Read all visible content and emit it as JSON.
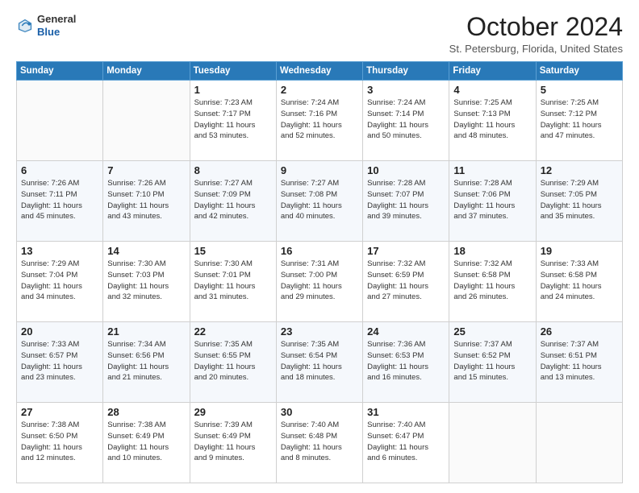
{
  "header": {
    "logo_general": "General",
    "logo_blue": "Blue",
    "month_title": "October 2024",
    "location": "St. Petersburg, Florida, United States"
  },
  "days_of_week": [
    "Sunday",
    "Monday",
    "Tuesday",
    "Wednesday",
    "Thursday",
    "Friday",
    "Saturday"
  ],
  "weeks": [
    [
      {
        "day": "",
        "detail": ""
      },
      {
        "day": "",
        "detail": ""
      },
      {
        "day": "1",
        "detail": "Sunrise: 7:23 AM\nSunset: 7:17 PM\nDaylight: 11 hours\nand 53 minutes."
      },
      {
        "day": "2",
        "detail": "Sunrise: 7:24 AM\nSunset: 7:16 PM\nDaylight: 11 hours\nand 52 minutes."
      },
      {
        "day": "3",
        "detail": "Sunrise: 7:24 AM\nSunset: 7:14 PM\nDaylight: 11 hours\nand 50 minutes."
      },
      {
        "day": "4",
        "detail": "Sunrise: 7:25 AM\nSunset: 7:13 PM\nDaylight: 11 hours\nand 48 minutes."
      },
      {
        "day": "5",
        "detail": "Sunrise: 7:25 AM\nSunset: 7:12 PM\nDaylight: 11 hours\nand 47 minutes."
      }
    ],
    [
      {
        "day": "6",
        "detail": "Sunrise: 7:26 AM\nSunset: 7:11 PM\nDaylight: 11 hours\nand 45 minutes."
      },
      {
        "day": "7",
        "detail": "Sunrise: 7:26 AM\nSunset: 7:10 PM\nDaylight: 11 hours\nand 43 minutes."
      },
      {
        "day": "8",
        "detail": "Sunrise: 7:27 AM\nSunset: 7:09 PM\nDaylight: 11 hours\nand 42 minutes."
      },
      {
        "day": "9",
        "detail": "Sunrise: 7:27 AM\nSunset: 7:08 PM\nDaylight: 11 hours\nand 40 minutes."
      },
      {
        "day": "10",
        "detail": "Sunrise: 7:28 AM\nSunset: 7:07 PM\nDaylight: 11 hours\nand 39 minutes."
      },
      {
        "day": "11",
        "detail": "Sunrise: 7:28 AM\nSunset: 7:06 PM\nDaylight: 11 hours\nand 37 minutes."
      },
      {
        "day": "12",
        "detail": "Sunrise: 7:29 AM\nSunset: 7:05 PM\nDaylight: 11 hours\nand 35 minutes."
      }
    ],
    [
      {
        "day": "13",
        "detail": "Sunrise: 7:29 AM\nSunset: 7:04 PM\nDaylight: 11 hours\nand 34 minutes."
      },
      {
        "day": "14",
        "detail": "Sunrise: 7:30 AM\nSunset: 7:03 PM\nDaylight: 11 hours\nand 32 minutes."
      },
      {
        "day": "15",
        "detail": "Sunrise: 7:30 AM\nSunset: 7:01 PM\nDaylight: 11 hours\nand 31 minutes."
      },
      {
        "day": "16",
        "detail": "Sunrise: 7:31 AM\nSunset: 7:00 PM\nDaylight: 11 hours\nand 29 minutes."
      },
      {
        "day": "17",
        "detail": "Sunrise: 7:32 AM\nSunset: 6:59 PM\nDaylight: 11 hours\nand 27 minutes."
      },
      {
        "day": "18",
        "detail": "Sunrise: 7:32 AM\nSunset: 6:58 PM\nDaylight: 11 hours\nand 26 minutes."
      },
      {
        "day": "19",
        "detail": "Sunrise: 7:33 AM\nSunset: 6:58 PM\nDaylight: 11 hours\nand 24 minutes."
      }
    ],
    [
      {
        "day": "20",
        "detail": "Sunrise: 7:33 AM\nSunset: 6:57 PM\nDaylight: 11 hours\nand 23 minutes."
      },
      {
        "day": "21",
        "detail": "Sunrise: 7:34 AM\nSunset: 6:56 PM\nDaylight: 11 hours\nand 21 minutes."
      },
      {
        "day": "22",
        "detail": "Sunrise: 7:35 AM\nSunset: 6:55 PM\nDaylight: 11 hours\nand 20 minutes."
      },
      {
        "day": "23",
        "detail": "Sunrise: 7:35 AM\nSunset: 6:54 PM\nDaylight: 11 hours\nand 18 minutes."
      },
      {
        "day": "24",
        "detail": "Sunrise: 7:36 AM\nSunset: 6:53 PM\nDaylight: 11 hours\nand 16 minutes."
      },
      {
        "day": "25",
        "detail": "Sunrise: 7:37 AM\nSunset: 6:52 PM\nDaylight: 11 hours\nand 15 minutes."
      },
      {
        "day": "26",
        "detail": "Sunrise: 7:37 AM\nSunset: 6:51 PM\nDaylight: 11 hours\nand 13 minutes."
      }
    ],
    [
      {
        "day": "27",
        "detail": "Sunrise: 7:38 AM\nSunset: 6:50 PM\nDaylight: 11 hours\nand 12 minutes."
      },
      {
        "day": "28",
        "detail": "Sunrise: 7:38 AM\nSunset: 6:49 PM\nDaylight: 11 hours\nand 10 minutes."
      },
      {
        "day": "29",
        "detail": "Sunrise: 7:39 AM\nSunset: 6:49 PM\nDaylight: 11 hours\nand 9 minutes."
      },
      {
        "day": "30",
        "detail": "Sunrise: 7:40 AM\nSunset: 6:48 PM\nDaylight: 11 hours\nand 8 minutes."
      },
      {
        "day": "31",
        "detail": "Sunrise: 7:40 AM\nSunset: 6:47 PM\nDaylight: 11 hours\nand 6 minutes."
      },
      {
        "day": "",
        "detail": ""
      },
      {
        "day": "",
        "detail": ""
      }
    ]
  ]
}
